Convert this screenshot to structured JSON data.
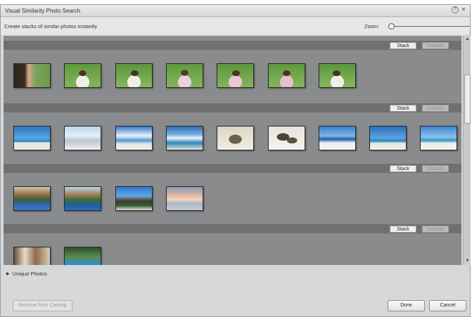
{
  "window": {
    "title": "Visual Similarity Photo Search"
  },
  "toolbar": {
    "subtitle": "Create stacks of similar photos instantly",
    "zoom_label": "Zoom:"
  },
  "groups": [
    {
      "stack_label": "Stack",
      "unstack_label": "Unstack",
      "photos": [
        "girl-with-adult",
        "girl-towel-1",
        "girl-towel-2",
        "girl-towel-3",
        "girl-towel-4",
        "girl-towel-5",
        "girl-towel-6"
      ]
    },
    {
      "stack_label": "Stack",
      "unstack_label": "Unstack",
      "photos": [
        "beach-palm-1",
        "beach-white-sand",
        "beach-clouds",
        "beach-sky",
        "rocks-sand-1",
        "rocks-sand-2",
        "beach-sea",
        "beach-palm-2",
        "beach-palm-3"
      ]
    },
    {
      "stack_label": "Stack",
      "unstack_label": "Unstack",
      "photos": [
        "hut-pool-1",
        "hut-palms",
        "hut-blue-sky",
        "sunset-sea"
      ]
    },
    {
      "stack_label": "Stack",
      "unstack_label": "Unstack",
      "photos": [
        "interior-room",
        "resort-pool"
      ]
    }
  ],
  "footer": {
    "unique_label": "Unique Photos",
    "remove_label": "Remove from Catalog",
    "done_label": "Done",
    "cancel_label": "Cancel"
  },
  "colors": {
    "content_bg": "#8a8b8d",
    "group_header": "#6f7072",
    "window_bg": "#d7d8da"
  },
  "zoom": {
    "level": 0
  }
}
